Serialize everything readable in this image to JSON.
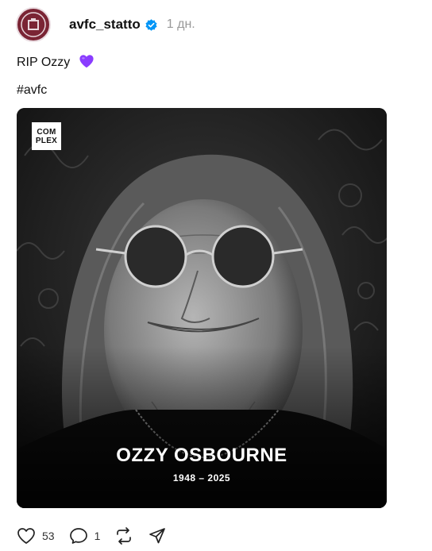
{
  "post": {
    "username": "avfc_statto",
    "time": "1 дн.",
    "caption_text": "RIP Ozzy",
    "caption_emoji": "purple-heart",
    "hashtag": "#avfc"
  },
  "media": {
    "logo_line1": "COM",
    "logo_line2": "PLEX",
    "name": "OZZY OSBOURNE",
    "years": "1948 – 2025"
  },
  "actions": {
    "likes": "53",
    "comments": "1"
  },
  "colors": {
    "avatar": "#7a2434",
    "verified": "#0095f6",
    "emoji": "#8a3cff"
  }
}
